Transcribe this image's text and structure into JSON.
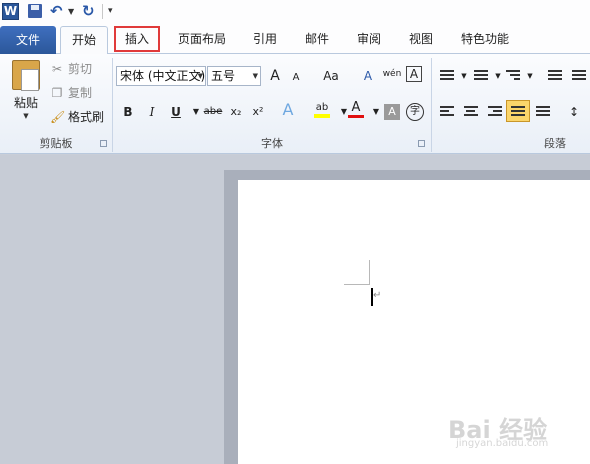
{
  "quick_access": {
    "app_logo": "W",
    "icons": [
      "word-logo-icon",
      "save-icon",
      "undo-icon",
      "undo-dropdown-icon",
      "repeat-icon",
      "customize-qat-icon"
    ]
  },
  "tabs": {
    "file": "文件",
    "home": "开始",
    "insert": "插入",
    "layout": "页面布局",
    "references": "引用",
    "mailings": "邮件",
    "review": "审阅",
    "view": "视图",
    "special": "特色功能"
  },
  "clipboard": {
    "paste": "粘贴",
    "cut": "剪切",
    "copy": "复制",
    "format_painter": "格式刷",
    "group_label": "剪贴板"
  },
  "font": {
    "font_name": "宋体 (中文正文)",
    "font_size": "五号",
    "grow": "A",
    "shrink": "A",
    "change_case": "Aa",
    "clear_format": "A",
    "phonetic": "wén",
    "char_border": "A",
    "bold": "B",
    "italic": "I",
    "underline": "U",
    "strike": "abe",
    "subscript": "x₂",
    "superscript": "x²",
    "text_effect": "A",
    "highlight": "ab",
    "font_color": "A",
    "char_shading": "A",
    "enclose": "字",
    "group_label": "字体"
  },
  "paragraph": {
    "group_label": "段落"
  },
  "colors": {
    "file_tab": "#2b579a",
    "highlight_box": "#e03a3a",
    "highlight_yellow": "#ffff00",
    "font_red": "#e01010",
    "doc_background": "#c7ccd6"
  },
  "watermark": {
    "brand": "Bai 经验",
    "url": "jingyan.baidu.com"
  }
}
